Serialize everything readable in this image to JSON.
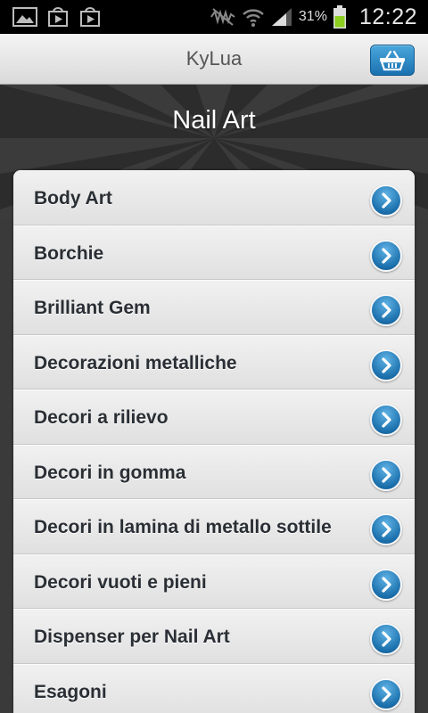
{
  "status_bar": {
    "icons": [
      "image-icon",
      "play-store-icon",
      "shop-icon",
      "mute-icon",
      "wifi-icon",
      "signal-icon",
      "battery-icon"
    ],
    "battery": "31%",
    "time": "12:22"
  },
  "header": {
    "title": "KyLua",
    "cart_icon": "basket-icon",
    "accent": "#1f7dbf"
  },
  "banner": {
    "title": "Nail Art"
  },
  "categories": [
    {
      "label": "Body Art"
    },
    {
      "label": "Borchie"
    },
    {
      "label": "Brilliant Gem"
    },
    {
      "label": "Decorazioni metalliche"
    },
    {
      "label": "Decori a rilievo"
    },
    {
      "label": "Decori in gomma"
    },
    {
      "label": "Decori in lamina di metallo sottile"
    },
    {
      "label": "Decori vuoti e pieni"
    },
    {
      "label": "Dispenser per Nail Art"
    },
    {
      "label": "Esagoni"
    }
  ]
}
